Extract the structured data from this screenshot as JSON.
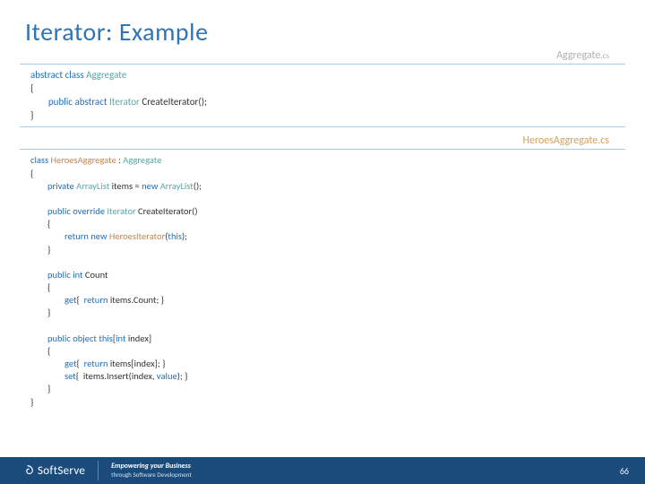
{
  "title": "Iterator: Example",
  "file1": {
    "name": "Aggregate",
    "ext": ".cs"
  },
  "file2": "HeroesAggregate.cs",
  "code1": {
    "l1a": "abstract",
    "l1b": "class",
    "l1c": "Aggregate",
    "l2": "{",
    "l3a": "public",
    "l3b": "abstract",
    "l3c": "Iterator",
    "l3d": " CreateIterator();",
    "l4": "}"
  },
  "code2": {
    "l1a": "class",
    "l1b": "HeroesAggregate",
    "l1c": " : ",
    "l1d": "Aggregate",
    "l2": "{",
    "l3a": "private",
    "l3b": "ArrayList",
    "l3c": " items = ",
    "l3d": "new",
    "l3e": "ArrayList",
    "l3f": "();",
    "l4": "",
    "l5a": "public",
    "l5b": "override",
    "l5c": "Iterator",
    "l5d": " CreateIterator()",
    "l6": "        {",
    "l7a": "return",
    "l7b": "new",
    "l7c": "HeroesIterator",
    "l7d": "(",
    "l7e": "this",
    "l7f": ");",
    "l8": "        }",
    "l9": "",
    "l10a": "public",
    "l10b": "int",
    "l10c": " Count",
    "l11": "        {",
    "l12a": "get",
    "l12b": "{  ",
    "l12c": "return",
    "l12d": " items.Count; }",
    "l13": "        }",
    "l14": "",
    "l15a": "public",
    "l15b": "object",
    "l15c": "this",
    "l15d": "[",
    "l15e": "int",
    "l15f": " index]",
    "l16": "        {",
    "l17a": "get",
    "l17b": "{  ",
    "l17c": "return",
    "l17d": " items[index]; }",
    "l18a": "set",
    "l18b": "{  items.Insert(index, ",
    "l18c": "value",
    "l18d": "); }",
    "l19": "        }",
    "l20": "}"
  },
  "footer": {
    "brand": "SoftServe",
    "tag1": "Empowering your Business",
    "tag2": "through Software Development"
  },
  "pagenum": "66"
}
